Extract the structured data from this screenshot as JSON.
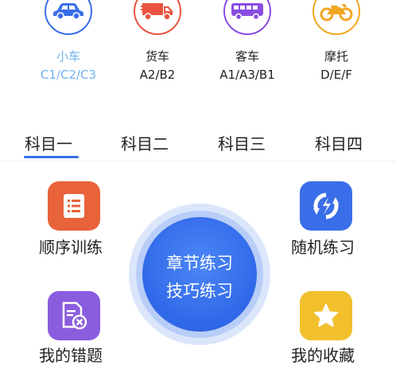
{
  "vehicles": [
    {
      "name": "小车",
      "code": "C1/C2/C3",
      "color": "#3a6ee8",
      "selected": true,
      "icon": "car-icon"
    },
    {
      "name": "货车",
      "code": "A2/B2",
      "color": "#e8543f",
      "selected": false,
      "icon": "truck-icon"
    },
    {
      "name": "客车",
      "code": "A1/A3/B1",
      "color": "#8a4de0",
      "selected": false,
      "icon": "bus-icon"
    },
    {
      "name": "摩托",
      "code": "D/E/F",
      "color": "#f2a623",
      "selected": false,
      "icon": "motorcycle-icon"
    }
  ],
  "tabs": [
    "科目一",
    "科目二",
    "科目三",
    "科目四"
  ],
  "active_tab": 0,
  "features": {
    "sequential": {
      "label": "顺序训练",
      "color": "#e8623a",
      "icon": "list-icon"
    },
    "random": {
      "label": "随机练习",
      "color": "#3a6ee8",
      "icon": "shuffle-icon"
    },
    "mistakes": {
      "label": "我的错题",
      "color": "#8a5ddf",
      "icon": "wrong-doc-icon"
    },
    "favorites": {
      "label": "我的收藏",
      "color": "#f1c02c",
      "icon": "star-icon"
    }
  },
  "center": {
    "line1": "章节练习",
    "line2": "技巧练习"
  },
  "colors": {
    "accent": "#3a6ee8",
    "selected_text": "#6fb2ef",
    "text": "#222222"
  }
}
